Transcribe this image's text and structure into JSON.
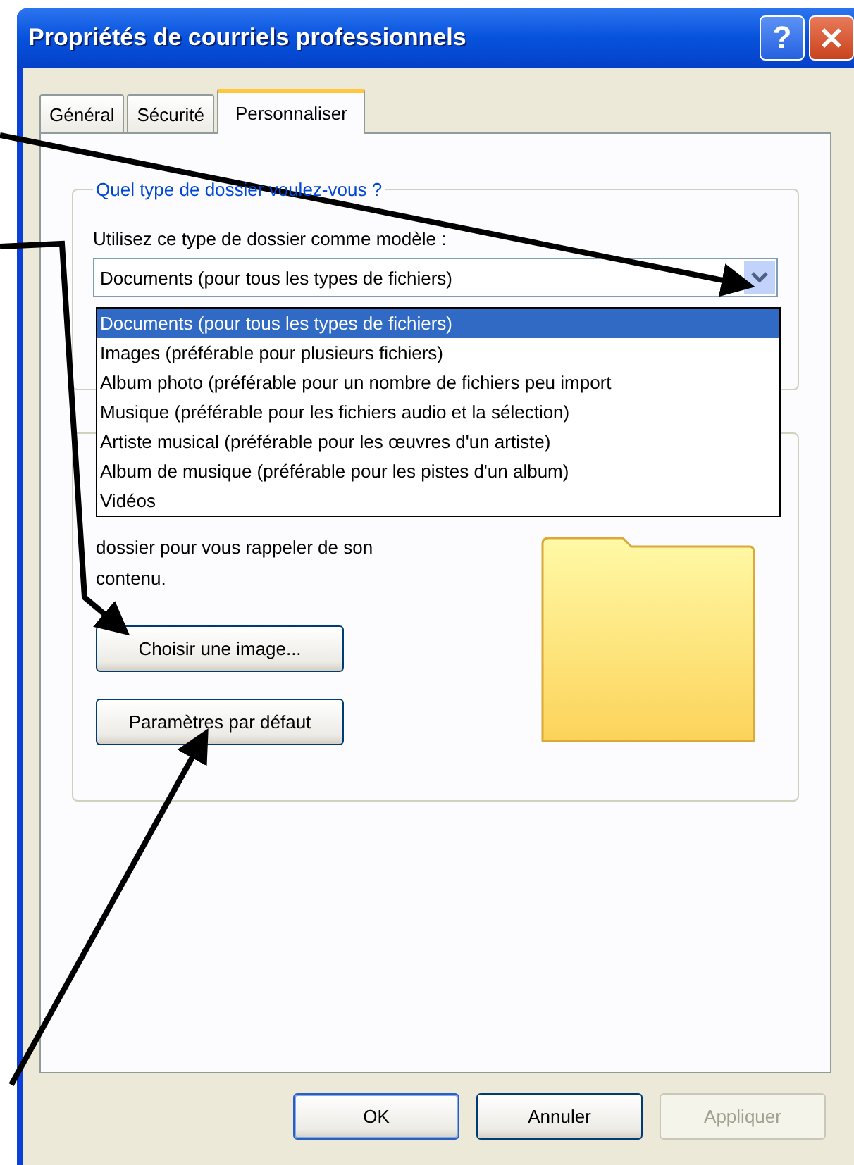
{
  "window": {
    "title": "Propriétés de courriels professionnels",
    "help_button": "?"
  },
  "tabs": [
    {
      "label": "Général",
      "selected": false
    },
    {
      "label": "Sécurité",
      "selected": false
    },
    {
      "label": "Personnaliser",
      "selected": true
    }
  ],
  "folder_type_group": {
    "legend": "Quel type de dossier voulez-vous ?",
    "label": "Utilisez ce type de dossier comme modèle :",
    "combo": {
      "value": "Documents (pour tous les types de fichiers)",
      "expanded": true
    },
    "dropdown": [
      {
        "label": "Documents (pour tous les types de fichiers)",
        "selected": true
      },
      {
        "label": "Images (préférable pour plusieurs fichiers)",
        "selected": false
      },
      {
        "label": "Album photo (préférable pour un nombre de fichiers peu import",
        "selected": false
      },
      {
        "label": "Musique (préférable pour les fichiers audio et la sélection)",
        "selected": false
      },
      {
        "label": "Artiste musical (préférable pour les œuvres d'un artiste)",
        "selected": false
      },
      {
        "label": "Album de musique (préférable pour les pistes d'un album)",
        "selected": false
      },
      {
        "label": "Vidéos",
        "selected": false
      }
    ]
  },
  "folder_picture_group": {
    "description_lines": [
      "dossier pour vous rappeler de son",
      "contenu."
    ],
    "buttons": [
      "Choisir une image...",
      "Paramètres par défaut"
    ]
  },
  "footer_buttons": [
    {
      "label": "OK",
      "default": true,
      "disabled": false
    },
    {
      "label": "Annuler",
      "default": false,
      "disabled": false
    },
    {
      "label": "Appliquer",
      "default": false,
      "disabled": true
    }
  ]
}
